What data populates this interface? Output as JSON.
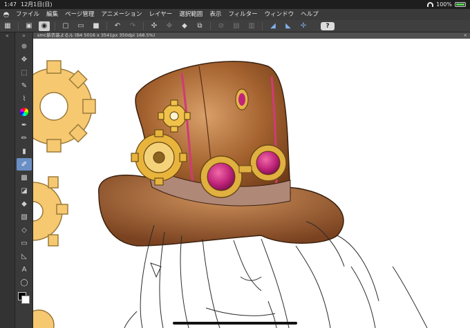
{
  "status": {
    "time": "1:47",
    "date": "12月1日(日)",
    "battery": "100%"
  },
  "menu": {
    "items": [
      "ファイル",
      "編集",
      "ページ管理",
      "アニメーション",
      "レイヤー",
      "選択範囲",
      "表示",
      "フィルター",
      "ウィンドウ",
      "ヘルプ"
    ]
  },
  "toolbar": {
    "help_label": "?"
  },
  "document": {
    "tab_title": "smc新衣装よるル (B4 5016 x 3541px 350dpi 168.5%)",
    "close_label": "×"
  },
  "colors": {
    "hat_brown": "#9a5a2c",
    "hat_highlight": "#c98a55",
    "gear_gold": "#f6c870",
    "goggle_magenta": "#c0247a",
    "accent_blue": "#6a8fc4"
  },
  "icons": {
    "app": "clip-studio-icon",
    "left_panel": [
      "navigator-icon",
      "layer-icon",
      "material-icon",
      "search-icon",
      "gradient-icon",
      "brush-icon",
      "color-icon"
    ],
    "tools": [
      "zoom-icon",
      "move-icon",
      "select-icon",
      "lasso-icon",
      "eyedropper-icon",
      "pen-icon",
      "pencil-icon",
      "brush-icon",
      "airbrush-icon",
      "decoration-icon",
      "eraser-icon",
      "fill-icon",
      "gradient-icon",
      "figure-icon",
      "frame-icon",
      "ruler-icon",
      "text-icon",
      "balloon-icon",
      "correct-line-icon"
    ]
  }
}
